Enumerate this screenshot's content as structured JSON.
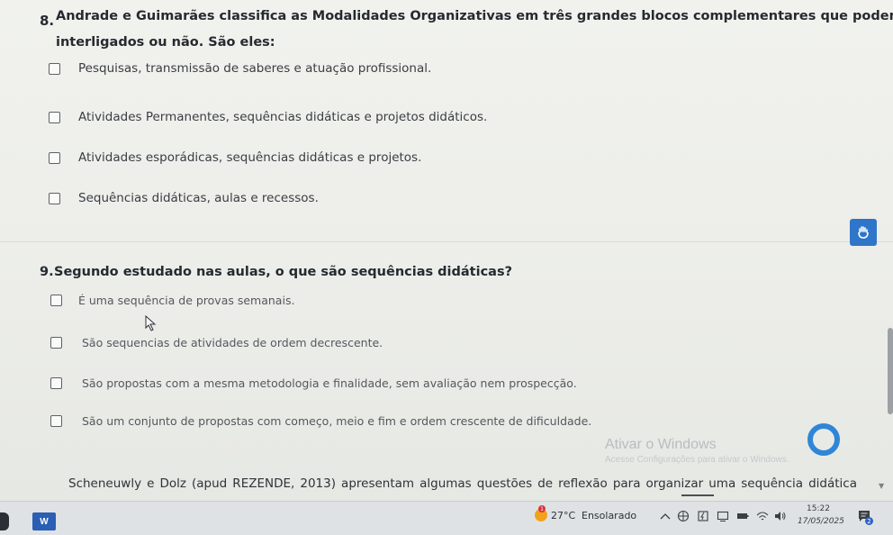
{
  "questions": [
    {
      "number": "8.",
      "text_line1": "Andrade e Guimarães classifica as Modalidades Organizativas em três grandes blocos complementares que podem ser",
      "text_line2": "interligados ou não. São eles:",
      "options": [
        "Pesquisas, transmissão de saberes e atuação profissional.",
        "Atividades Permanentes, sequências didáticas e projetos didáticos.",
        "Atividades esporádicas, sequências didáticas e projetos.",
        "Sequências didáticas, aulas e recessos."
      ]
    },
    {
      "number": "9.",
      "text": "Segundo estudado nas aulas, o que são sequências didáticas?",
      "options": [
        "É uma sequência de provas semanais.",
        "São sequencias de atividades de ordem decrescente.",
        "São propostas com a mesma metodologia e finalidade, sem avaliação nem prospecção.",
        "São um conjunto de propostas com começo, meio e fim e ordem crescente de dificuldade."
      ]
    }
  ],
  "paragraph": "Scheneuwly e Dolz (apud REZENDE, 2013) apresentam algumas questões de reflexão para organizar uma sequência didática",
  "watermark": {
    "title": "Ativar o Windows",
    "subtitle": "Acesse Configurações para ativar o Windows."
  },
  "taskbar": {
    "word_label": "W",
    "weather_alert": "1",
    "temperature": "27°C",
    "condition": "Ensolarado",
    "time": "15:22",
    "date": "17/05/2025",
    "notification_count": "2"
  },
  "colors": {
    "accent": "#2f75c9",
    "watermark": "#b9bcc0"
  }
}
